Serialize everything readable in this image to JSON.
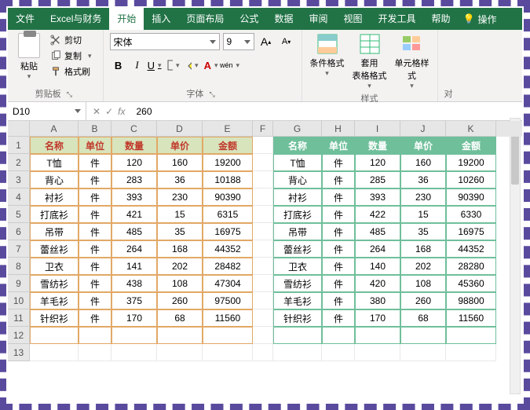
{
  "tabs": {
    "file": "文件",
    "excel_finance": "Excel与财务",
    "home": "开始",
    "insert": "插入",
    "page_layout": "页面布局",
    "formulas": "公式",
    "data": "数据",
    "review": "审阅",
    "view": "视图",
    "dev_tools": "开发工具",
    "help": "帮助",
    "tell_me": "操作"
  },
  "ribbon": {
    "clipboard": {
      "paste": "粘贴",
      "cut": "剪切",
      "copy": "复制",
      "format_painter": "格式刷",
      "group_label": "剪贴板"
    },
    "font": {
      "name": "宋体",
      "size": "9",
      "bold": "B",
      "italic": "I",
      "underline": "U",
      "wen": "wén",
      "group_label": "字体",
      "increase": "A",
      "decrease": "A"
    },
    "styles": {
      "conditional": "条件格式",
      "format_table": "套用\n表格格式",
      "cell_styles": "单元格样式",
      "group_label": "样式"
    },
    "align_label": "对"
  },
  "fxbar": {
    "namebox": "D10",
    "fx": "fx",
    "value": "260"
  },
  "columns": [
    "A",
    "B",
    "C",
    "D",
    "E",
    "F",
    "G",
    "H",
    "I",
    "J",
    "K"
  ],
  "row_numbers": [
    "1",
    "2",
    "3",
    "4",
    "5",
    "6",
    "7",
    "8",
    "9",
    "10",
    "11",
    "12",
    "13"
  ],
  "table1": {
    "headers": {
      "name": "名称",
      "unit": "单位",
      "qty": "数量",
      "price": "单价",
      "amount": "金额"
    },
    "rows": [
      {
        "name": "T恤",
        "unit": "件",
        "qty": "120",
        "price": "160",
        "amount": "19200"
      },
      {
        "name": "背心",
        "unit": "件",
        "qty": "283",
        "price": "36",
        "amount": "10188"
      },
      {
        "name": "衬衫",
        "unit": "件",
        "qty": "393",
        "price": "230",
        "amount": "90390"
      },
      {
        "name": "打底衫",
        "unit": "件",
        "qty": "421",
        "price": "15",
        "amount": "6315"
      },
      {
        "name": "吊带",
        "unit": "件",
        "qty": "485",
        "price": "35",
        "amount": "16975"
      },
      {
        "name": "蕾丝衫",
        "unit": "件",
        "qty": "264",
        "price": "168",
        "amount": "44352"
      },
      {
        "name": "卫衣",
        "unit": "件",
        "qty": "141",
        "price": "202",
        "amount": "28482"
      },
      {
        "name": "雪纺衫",
        "unit": "件",
        "qty": "438",
        "price": "108",
        "amount": "47304"
      },
      {
        "name": "羊毛衫",
        "unit": "件",
        "qty": "375",
        "price": "260",
        "amount": "97500"
      },
      {
        "name": "针织衫",
        "unit": "件",
        "qty": "170",
        "price": "68",
        "amount": "11560"
      }
    ]
  },
  "table2": {
    "headers": {
      "name": "名称",
      "unit": "单位",
      "qty": "数量",
      "price": "单价",
      "amount": "金额"
    },
    "rows": [
      {
        "name": "T恤",
        "unit": "件",
        "qty": "120",
        "price": "160",
        "amount": "19200"
      },
      {
        "name": "背心",
        "unit": "件",
        "qty": "285",
        "price": "36",
        "amount": "10260"
      },
      {
        "name": "衬衫",
        "unit": "件",
        "qty": "393",
        "price": "230",
        "amount": "90390"
      },
      {
        "name": "打底衫",
        "unit": "件",
        "qty": "422",
        "price": "15",
        "amount": "6330"
      },
      {
        "name": "吊带",
        "unit": "件",
        "qty": "485",
        "price": "35",
        "amount": "16975"
      },
      {
        "name": "蕾丝衫",
        "unit": "件",
        "qty": "264",
        "price": "168",
        "amount": "44352"
      },
      {
        "name": "卫衣",
        "unit": "件",
        "qty": "140",
        "price": "202",
        "amount": "28280"
      },
      {
        "name": "雪纺衫",
        "unit": "件",
        "qty": "420",
        "price": "108",
        "amount": "45360"
      },
      {
        "name": "羊毛衫",
        "unit": "件",
        "qty": "380",
        "price": "260",
        "amount": "98800"
      },
      {
        "name": "针织衫",
        "unit": "件",
        "qty": "170",
        "price": "68",
        "amount": "11560"
      }
    ]
  }
}
